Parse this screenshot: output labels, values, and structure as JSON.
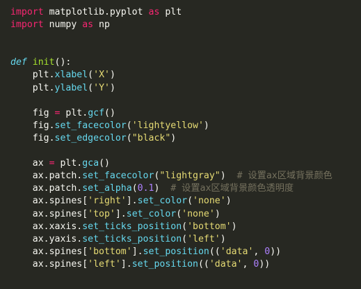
{
  "code_lines": [
    [
      {
        "t": "import",
        "c": "kw"
      },
      {
        "t": " matplotlib.pyplot ",
        "c": "plain"
      },
      {
        "t": "as",
        "c": "kw"
      },
      {
        "t": " plt",
        "c": "plain"
      }
    ],
    [
      {
        "t": "import",
        "c": "kw"
      },
      {
        "t": " numpy ",
        "c": "plain"
      },
      {
        "t": "as",
        "c": "kw"
      },
      {
        "t": " np",
        "c": "plain"
      }
    ],
    [],
    [],
    [
      {
        "t": "def",
        "c": "def"
      },
      {
        "t": " ",
        "c": "plain"
      },
      {
        "t": "init",
        "c": "fn"
      },
      {
        "t": "():",
        "c": "plain"
      }
    ],
    [
      {
        "t": "    plt.",
        "c": "plain"
      },
      {
        "t": "xlabel",
        "c": "attr"
      },
      {
        "t": "(",
        "c": "plain"
      },
      {
        "t": "'X'",
        "c": "str"
      },
      {
        "t": ")",
        "c": "plain"
      }
    ],
    [
      {
        "t": "    plt.",
        "c": "plain"
      },
      {
        "t": "ylabel",
        "c": "attr"
      },
      {
        "t": "(",
        "c": "plain"
      },
      {
        "t": "'Y'",
        "c": "str"
      },
      {
        "t": ")",
        "c": "plain"
      }
    ],
    [],
    [
      {
        "t": "    fig ",
        "c": "plain"
      },
      {
        "t": "=",
        "c": "op"
      },
      {
        "t": " plt.",
        "c": "plain"
      },
      {
        "t": "gcf",
        "c": "attr"
      },
      {
        "t": "()",
        "c": "plain"
      }
    ],
    [
      {
        "t": "    fig.",
        "c": "plain"
      },
      {
        "t": "set_facecolor",
        "c": "attr"
      },
      {
        "t": "(",
        "c": "plain"
      },
      {
        "t": "'lightyellow'",
        "c": "str"
      },
      {
        "t": ")",
        "c": "plain"
      }
    ],
    [
      {
        "t": "    fig.",
        "c": "plain"
      },
      {
        "t": "set_edgecolor",
        "c": "attr"
      },
      {
        "t": "(",
        "c": "plain"
      },
      {
        "t": "\"black\"",
        "c": "str"
      },
      {
        "t": ")",
        "c": "plain"
      }
    ],
    [],
    [
      {
        "t": "    ax ",
        "c": "plain"
      },
      {
        "t": "=",
        "c": "op"
      },
      {
        "t": " plt.",
        "c": "plain"
      },
      {
        "t": "gca",
        "c": "attr"
      },
      {
        "t": "()",
        "c": "plain"
      }
    ],
    [
      {
        "t": "    ax.patch.",
        "c": "plain"
      },
      {
        "t": "set_facecolor",
        "c": "attr"
      },
      {
        "t": "(",
        "c": "plain"
      },
      {
        "t": "\"lightgray\"",
        "c": "str"
      },
      {
        "t": ")  ",
        "c": "plain"
      },
      {
        "t": "# 设置ax区域背景颜色",
        "c": "cm"
      }
    ],
    [
      {
        "t": "    ax.patch.",
        "c": "plain"
      },
      {
        "t": "set_alpha",
        "c": "attr"
      },
      {
        "t": "(",
        "c": "plain"
      },
      {
        "t": "0.1",
        "c": "num"
      },
      {
        "t": ")  ",
        "c": "plain"
      },
      {
        "t": "# 设置ax区域背景颜色透明度",
        "c": "cm"
      }
    ],
    [
      {
        "t": "    ax.spines[",
        "c": "plain"
      },
      {
        "t": "'right'",
        "c": "str"
      },
      {
        "t": "].",
        "c": "plain"
      },
      {
        "t": "set_color",
        "c": "attr"
      },
      {
        "t": "(",
        "c": "plain"
      },
      {
        "t": "'none'",
        "c": "str"
      },
      {
        "t": ")",
        "c": "plain"
      }
    ],
    [
      {
        "t": "    ax.spines[",
        "c": "plain"
      },
      {
        "t": "'top'",
        "c": "str"
      },
      {
        "t": "].",
        "c": "plain"
      },
      {
        "t": "set_color",
        "c": "attr"
      },
      {
        "t": "(",
        "c": "plain"
      },
      {
        "t": "'none'",
        "c": "str"
      },
      {
        "t": ")",
        "c": "plain"
      }
    ],
    [
      {
        "t": "    ax.xaxis.",
        "c": "plain"
      },
      {
        "t": "set_ticks_position",
        "c": "attr"
      },
      {
        "t": "(",
        "c": "plain"
      },
      {
        "t": "'bottom'",
        "c": "str"
      },
      {
        "t": ")",
        "c": "plain"
      }
    ],
    [
      {
        "t": "    ax.yaxis.",
        "c": "plain"
      },
      {
        "t": "set_ticks_position",
        "c": "attr"
      },
      {
        "t": "(",
        "c": "plain"
      },
      {
        "t": "'left'",
        "c": "str"
      },
      {
        "t": ")",
        "c": "plain"
      }
    ],
    [
      {
        "t": "    ax.spines[",
        "c": "plain"
      },
      {
        "t": "'bottom'",
        "c": "str"
      },
      {
        "t": "].",
        "c": "plain"
      },
      {
        "t": "set_position",
        "c": "attr"
      },
      {
        "t": "((",
        "c": "plain"
      },
      {
        "t": "'data'",
        "c": "str"
      },
      {
        "t": ", ",
        "c": "plain"
      },
      {
        "t": "0",
        "c": "num"
      },
      {
        "t": "))",
        "c": "plain"
      }
    ],
    [
      {
        "t": "    ax.spines[",
        "c": "plain"
      },
      {
        "t": "'left'",
        "c": "str"
      },
      {
        "t": "].",
        "c": "plain"
      },
      {
        "t": "set_position",
        "c": "attr"
      },
      {
        "t": "((",
        "c": "plain"
      },
      {
        "t": "'data'",
        "c": "str"
      },
      {
        "t": ", ",
        "c": "plain"
      },
      {
        "t": "0",
        "c": "num"
      },
      {
        "t": "))",
        "c": "plain"
      }
    ]
  ],
  "colors": {
    "background": "#272822",
    "keyword": "#f92672",
    "function": "#a6e22e",
    "string": "#e6db74",
    "number": "#ae81ff",
    "comment": "#75715e",
    "attribute": "#66d9ef",
    "text": "#f8f8f2"
  }
}
